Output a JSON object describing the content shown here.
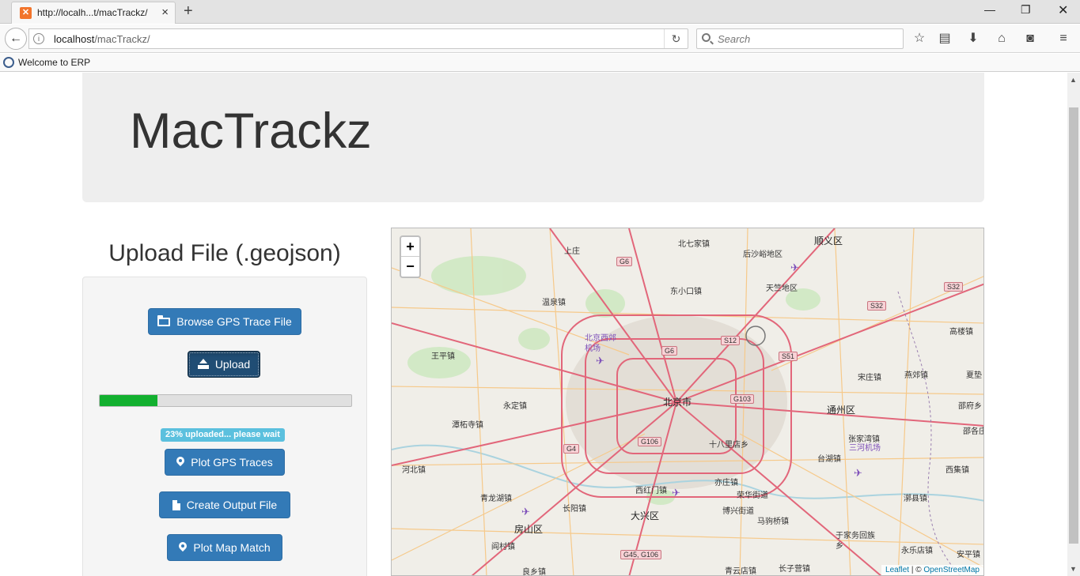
{
  "browser": {
    "tab_title": "http://localh...t/macTrackz/",
    "url_host": "localhost",
    "url_path": "/macTrackz/",
    "search_placeholder": "Search",
    "bookmark_label": "Welcome to ERP"
  },
  "page": {
    "title": "MacTrackz",
    "upload_heading": "Upload File (.geojson)",
    "buttons": {
      "browse": "Browse GPS Trace File",
      "upload": "Upload",
      "plot_traces": "Plot GPS Traces",
      "create_output": "Create Output File",
      "plot_match": "Plot Map Match"
    },
    "progress_fraction": 0.23,
    "status_label": "23% uploaded... please wait"
  },
  "map": {
    "zoom_in": "+",
    "zoom_out": "−",
    "attribution_leaflet": "Leaflet",
    "attribution_sep": " | © ",
    "attribution_osm": "OpenStreetMap",
    "labels": {
      "l1": "北七家镇",
      "l2": "顺义区",
      "l3": "上庄",
      "l4": "后沙峪地区",
      "l5": "东小口镇",
      "l6": "天竺地区",
      "l7": "温泉镇",
      "l8": "高楼镇",
      "l9": "北京西郊机场",
      "l10": "王平镇",
      "l11": "宋庄镇",
      "l12": "燕郊镇",
      "l13": "夏垫",
      "l14": "永定镇",
      "l15": "北京市",
      "l16": "通州区",
      "l17": "潭柘寺镇",
      "l18": "邵府乡",
      "l19": "十八里店乡",
      "l20": "张家湾镇",
      "l21": "邵各庄镇",
      "l22": "三河机场",
      "l23": "台湖镇",
      "l24": "河北镇",
      "l25": "西集镇",
      "l26": "亦庄镇",
      "l27": "青龙湖镇",
      "l28": "西红门镇",
      "l29": "荣华街道",
      "l30": "长阳镇",
      "l31": "博兴街道",
      "l32": "漷县镇",
      "l33": "大兴区",
      "l34": "房山区",
      "l35": "马驹桥镇",
      "l36": "于家务回族乡",
      "l37": "阎村镇",
      "l38": "永乐店镇",
      "l39": "安平镇",
      "l40": "良乡镇",
      "l41": "青云店镇",
      "l42": "长子营镇"
    },
    "shields": {
      "s1": "G6",
      "s2": "S32",
      "s3": "S32",
      "s4": "S12",
      "s5": "G6",
      "s6": "S51",
      "s7": "G103",
      "s8": "G106",
      "s9": "G4",
      "s10": "G45, G106"
    }
  },
  "colors": {
    "primary": "#337ab7",
    "progress": "#12b02f",
    "info_label": "#5bc0de",
    "jumbotron": "#eeeeee"
  },
  "icons": {
    "browse": "folder-open-icon",
    "upload": "upload-icon",
    "plot_traces": "map-marker-icon",
    "create_output": "file-icon",
    "plot_match": "map-marker-icon"
  }
}
